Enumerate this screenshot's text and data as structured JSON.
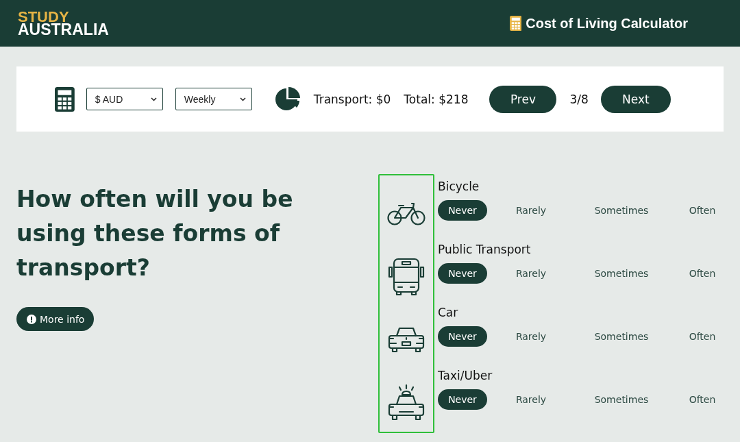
{
  "header": {
    "logo_top": "STUDY",
    "logo_bottom": "AUSTRALIA",
    "title": "Cost of Living Calculator"
  },
  "toolbar": {
    "currency": "$ AUD",
    "period": "Weekly",
    "category_total": "Transport: $0",
    "total": "Total: $218",
    "prev": "Prev",
    "step": "3/8",
    "next": "Next"
  },
  "question": {
    "heading": "How often will you be using these forms of transport?",
    "more_info": "More info"
  },
  "transports": [
    {
      "kind": "bicycle",
      "label": "Bicycle",
      "options": [
        {
          "label": "Never",
          "selected": true
        },
        {
          "label": "Rarely",
          "selected": false
        },
        {
          "label": "Sometimes",
          "selected": false
        },
        {
          "label": "Often",
          "selected": false
        }
      ]
    },
    {
      "kind": "bus",
      "label": "Public Transport",
      "options": [
        {
          "label": "Never",
          "selected": true
        },
        {
          "label": "Rarely",
          "selected": false
        },
        {
          "label": "Sometimes",
          "selected": false
        },
        {
          "label": "Often",
          "selected": false
        }
      ]
    },
    {
      "kind": "car",
      "label": "Car",
      "options": [
        {
          "label": "Never",
          "selected": true
        },
        {
          "label": "Rarely",
          "selected": false
        },
        {
          "label": "Sometimes",
          "selected": false
        },
        {
          "label": "Often",
          "selected": false
        }
      ]
    },
    {
      "kind": "taxi",
      "label": "Taxi/Uber",
      "options": [
        {
          "label": "Never",
          "selected": true
        },
        {
          "label": "Rarely",
          "selected": false
        },
        {
          "label": "Sometimes",
          "selected": false
        },
        {
          "label": "Often",
          "selected": false
        }
      ]
    }
  ]
}
